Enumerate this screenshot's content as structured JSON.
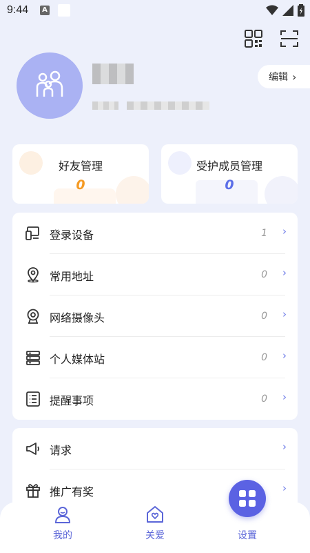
{
  "status_bar": {
    "time": "9:44",
    "notif_letter": "A"
  },
  "header": {
    "qr_icon": "qr-code-icon",
    "scan_icon": "scan-icon"
  },
  "profile": {
    "edit_label": "编辑",
    "edit_chevron": "›"
  },
  "stats": [
    {
      "label": "好友管理",
      "value": "0",
      "color": "#f59a23"
    },
    {
      "label": "受护成员管理",
      "value": "0",
      "color": "#5b6ee8"
    }
  ],
  "menu_primary": [
    {
      "label": "登录设备",
      "count": "1",
      "icon": "devices-icon"
    },
    {
      "label": "常用地址",
      "count": "0",
      "icon": "location-pin-icon"
    },
    {
      "label": "网络摄像头",
      "count": "0",
      "icon": "webcam-icon"
    },
    {
      "label": "个人媒体站",
      "count": "0",
      "icon": "server-icon"
    },
    {
      "label": "提醒事项",
      "count": "0",
      "icon": "list-icon"
    }
  ],
  "menu_secondary": [
    {
      "label": "请求",
      "icon": "megaphone-icon"
    },
    {
      "label": "推广有奖",
      "icon": "gift-icon"
    }
  ],
  "arrow": "›",
  "tabs": [
    {
      "label": "我的",
      "icon": "user-icon"
    },
    {
      "label": "关爱",
      "icon": "heart-house-icon"
    },
    {
      "label": "设置",
      "icon": "grid-icon"
    }
  ],
  "colors": {
    "accent": "#5b62e3",
    "background": "#edf0fb",
    "avatar": "#aab2f3"
  }
}
